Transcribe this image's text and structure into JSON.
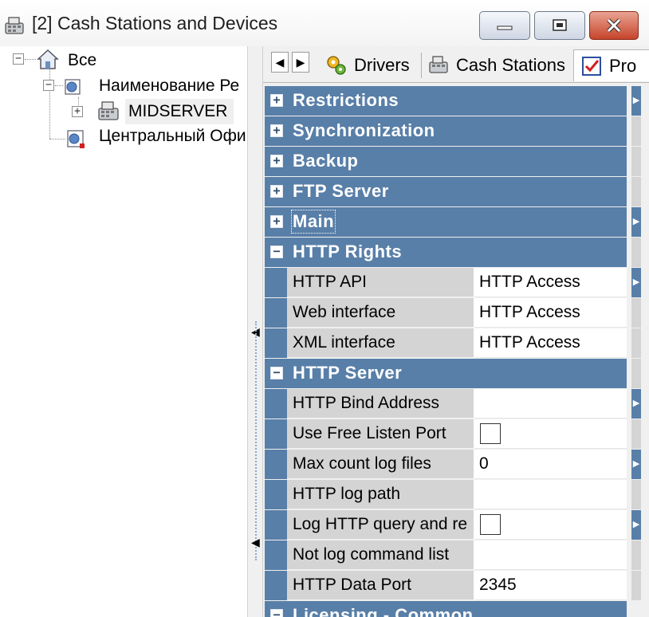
{
  "window": {
    "title": "[2] Cash Stations and Devices",
    "icon": "cash-register-icon",
    "controls": [
      "minimize-icon",
      "maximize-icon",
      "close-icon"
    ]
  },
  "tree": {
    "root": {
      "label": "Все",
      "expander": "−"
    },
    "child": {
      "label": "Наименование Ре",
      "expander": "−"
    },
    "grandchild": {
      "label": "MIDSERVER",
      "expander": "+"
    },
    "sibling": {
      "label": "Центральный Офи"
    }
  },
  "tabs": {
    "nav_left": "◀",
    "nav_right": "▶",
    "items": [
      {
        "label": "Drivers",
        "icon": "gears-icon"
      },
      {
        "label": "Cash Stations",
        "icon": "cash-register-icon"
      },
      {
        "label": "Pro",
        "icon": "checklist-icon"
      }
    ]
  },
  "grid": {
    "categories": {
      "restrictions": "Restrictions",
      "synchronization": "Synchronization",
      "backup": "Backup",
      "ftp": "FTP Server",
      "main": "Main",
      "http_rights": "HTTP Rights",
      "http_server": "HTTP Server",
      "licensing": "Licensing - Common"
    },
    "expand_symbol": "+",
    "collapse_symbol": "−",
    "http_rights": [
      {
        "name": "HTTP API",
        "value": "HTTP Access"
      },
      {
        "name": "Web interface",
        "value": "HTTP Access"
      },
      {
        "name": "XML interface",
        "value": "HTTP Access"
      }
    ],
    "http_server": [
      {
        "name": "HTTP Bind Address",
        "value": ""
      },
      {
        "name": "Use Free Listen Port",
        "value": ""
      },
      {
        "name": "Max count log files",
        "value": "0"
      },
      {
        "name": "HTTP log path",
        "value": ""
      },
      {
        "name": "Log HTTP query and re",
        "value": ""
      },
      {
        "name": "Not log command list",
        "value": ""
      },
      {
        "name": "HTTP Data Port",
        "value": "2345"
      }
    ]
  },
  "colors": {
    "category_bg": "#587fa8",
    "name_cell_bg": "#d4d4d4",
    "close_button": "#c7442b"
  }
}
